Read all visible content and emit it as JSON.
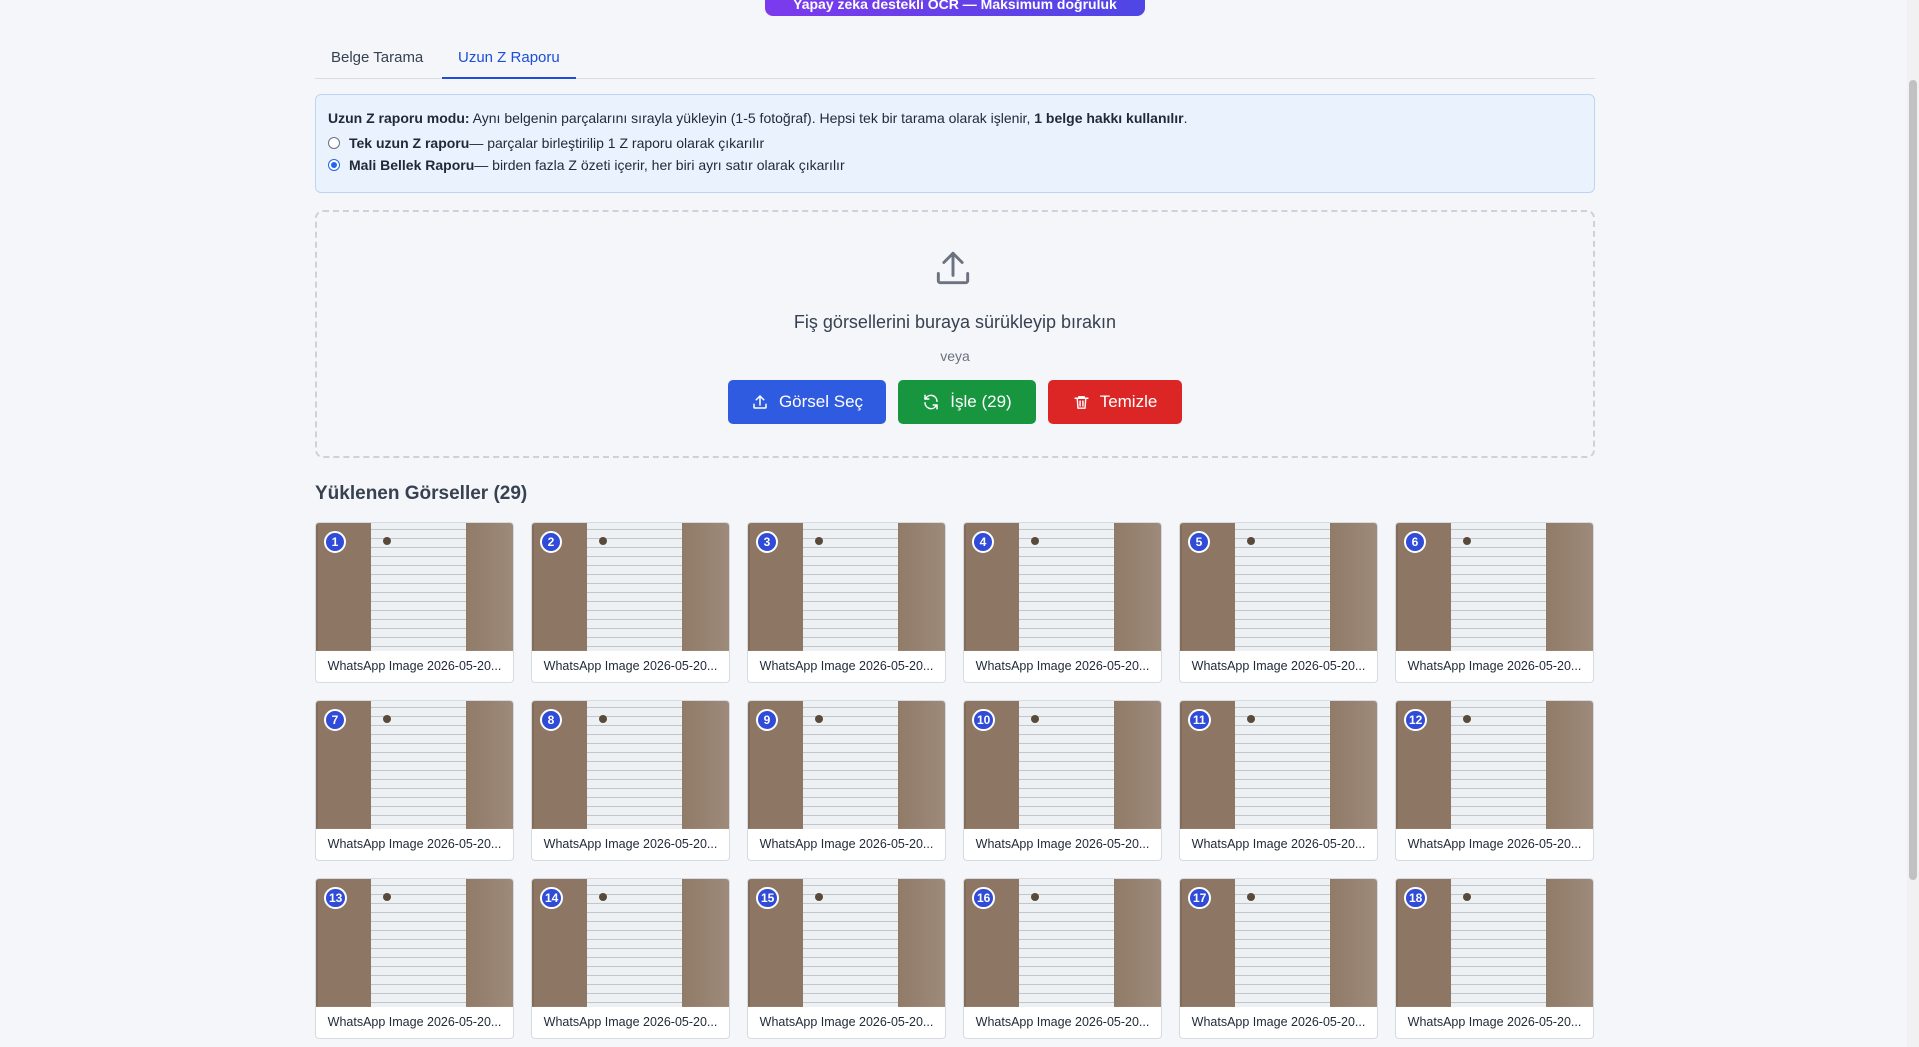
{
  "banner": {
    "text": "Yapay zeka destekli OCR — Maksimum doğruluk"
  },
  "tabs": [
    {
      "label": "Belge Tarama",
      "active": false
    },
    {
      "label": "Uzun Z Raporu",
      "active": true
    }
  ],
  "info": {
    "mode_label": "Uzun Z raporu modu:",
    "mode_text": " Aynı belgenin parçalarını sırayla yükleyin (1-5 fotoğraf). Hepsi tek bir tarama olarak işlenir, ",
    "mode_bold_end": "1 belge hakkı kullanılır",
    "mode_period": ".",
    "options": [
      {
        "title": "Tek uzun Z raporu",
        "desc": " — parçalar birleştirilip 1 Z raporu olarak çıkarılır",
        "checked": false
      },
      {
        "title": "Mali Bellek Raporu",
        "desc": " — birden fazla Z özeti içerir, her biri ayrı satır olarak çıkarılır",
        "checked": true
      }
    ]
  },
  "dropzone": {
    "text": "Fiş görsellerini buraya sürükleyip bırakın",
    "or": "veya",
    "select_button": "Görsel Seç",
    "process_button": "İşle (29)",
    "clear_button": "Temizle"
  },
  "uploaded": {
    "title": "Yüklenen Görseller (29)",
    "items": [
      {
        "number": "1",
        "name": "WhatsApp Image 2026-05-20..."
      },
      {
        "number": "2",
        "name": "WhatsApp Image 2026-05-20..."
      },
      {
        "number": "3",
        "name": "WhatsApp Image 2026-05-20..."
      },
      {
        "number": "4",
        "name": "WhatsApp Image 2026-05-20..."
      },
      {
        "number": "5",
        "name": "WhatsApp Image 2026-05-20..."
      },
      {
        "number": "6",
        "name": "WhatsApp Image 2026-05-20..."
      },
      {
        "number": "7",
        "name": "WhatsApp Image 2026-05-20..."
      },
      {
        "number": "8",
        "name": "WhatsApp Image 2026-05-20..."
      },
      {
        "number": "9",
        "name": "WhatsApp Image 2026-05-20..."
      },
      {
        "number": "10",
        "name": "WhatsApp Image 2026-05-20..."
      },
      {
        "number": "11",
        "name": "WhatsApp Image 2026-05-20..."
      },
      {
        "number": "12",
        "name": "WhatsApp Image 2026-05-20..."
      },
      {
        "number": "13",
        "name": "WhatsApp Image 2026-05-20..."
      },
      {
        "number": "14",
        "name": "WhatsApp Image 2026-05-20..."
      },
      {
        "number": "15",
        "name": "WhatsApp Image 2026-05-20..."
      },
      {
        "number": "16",
        "name": "WhatsApp Image 2026-05-20..."
      },
      {
        "number": "17",
        "name": "WhatsApp Image 2026-05-20..."
      },
      {
        "number": "18",
        "name": "WhatsApp Image 2026-05-20..."
      }
    ]
  },
  "colors": {
    "primary": "#2f5be0",
    "success": "#17953f",
    "danger": "#dc2626",
    "badge": "#2f4bd8",
    "banner_start": "#7c3aed",
    "banner_end": "#4f46e5"
  },
  "icons": {
    "dropzone": "upload-icon",
    "select_button": "upload-icon",
    "process_button": "refresh-icon",
    "clear_button": "trash-icon"
  }
}
